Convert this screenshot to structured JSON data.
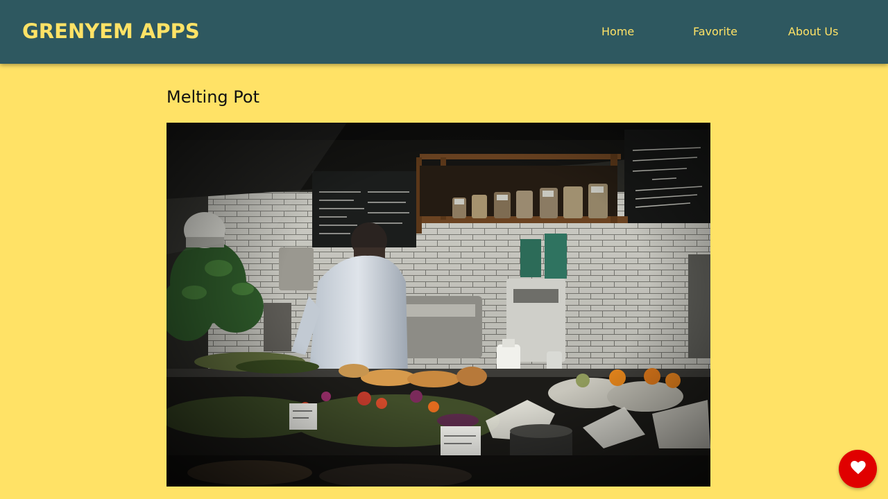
{
  "header": {
    "brand": "GRENYEM APPS",
    "nav": {
      "home": "Home",
      "favorite": "Favorite",
      "about": "About Us"
    }
  },
  "main": {
    "title": "Melting Pot",
    "image": {
      "alt": "Melting Pot"
    }
  },
  "fab": {
    "icon": "heart-icon"
  },
  "colors": {
    "header_bg": "#2E5860",
    "accent_yellow": "#FFE266",
    "fab_red": "#E00000"
  }
}
